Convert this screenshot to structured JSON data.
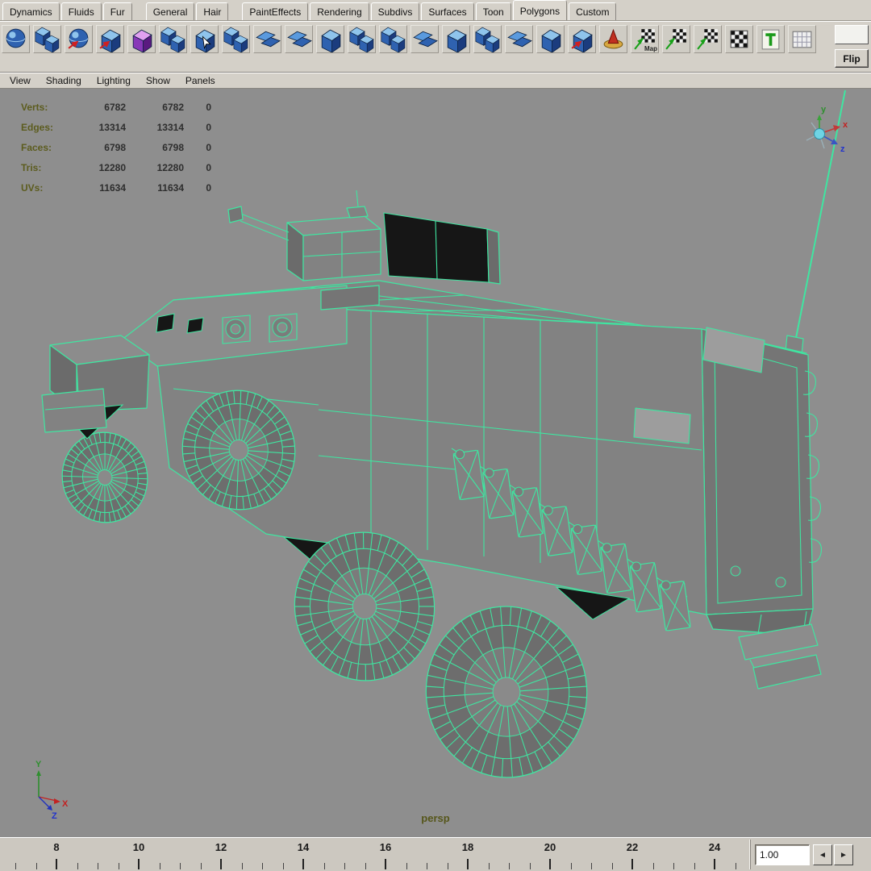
{
  "tabs": {
    "active_index": 10,
    "items": [
      {
        "label": "Dynamics"
      },
      {
        "label": "Fluids"
      },
      {
        "label": "Fur"
      },
      {
        "label": "General"
      },
      {
        "label": "Hair"
      },
      {
        "label": "PaintEffects"
      },
      {
        "label": "Rendering"
      },
      {
        "label": "Subdivs"
      },
      {
        "label": "Surfaces"
      },
      {
        "label": "Toon"
      },
      {
        "label": "Polygons"
      },
      {
        "label": "Custom"
      }
    ]
  },
  "shelf": {
    "flip_label": "Flip",
    "icons": [
      {
        "name": "shelf-poly-sphere-icon",
        "type": "sphere"
      },
      {
        "name": "shelf-poly-cubes-icon",
        "type": "cubes"
      },
      {
        "name": "shelf-smooth-sphere-icon",
        "type": "sphereArrow"
      },
      {
        "name": "shelf-poly-cube-arrow-icon",
        "type": "cubeArrow"
      },
      {
        "name": "shelf-poly-texture-cube-icon",
        "type": "cubePurple"
      },
      {
        "name": "shelf-poly-mirror-icon",
        "type": "cubes"
      },
      {
        "name": "shelf-smooth-proxy-icon",
        "type": "cubeCursor"
      },
      {
        "name": "shelf-poly-combine-icon",
        "type": "cubes"
      },
      {
        "name": "shelf-poly-extrude-icon",
        "type": "planes"
      },
      {
        "name": "shelf-poly-extrude-face-icon",
        "type": "planes"
      },
      {
        "name": "shelf-poly-bevel-icon",
        "type": "cube"
      },
      {
        "name": "shelf-poly-boolean-union-icon",
        "type": "cubes"
      },
      {
        "name": "shelf-poly-boolean-difference-icon",
        "type": "cubes"
      },
      {
        "name": "shelf-poly-triangulate-icon",
        "type": "planes"
      },
      {
        "name": "shelf-poly-quadrangulate-icon",
        "type": "cube"
      },
      {
        "name": "shelf-poly-merge-icon",
        "type": "cubes"
      },
      {
        "name": "shelf-poly-split-icon",
        "type": "planes"
      },
      {
        "name": "shelf-poly-subdivide-icon",
        "type": "cube"
      },
      {
        "name": "shelf-poly-smooth-icon",
        "type": "cubeArrow"
      },
      {
        "name": "shelf-sculpt-tool-icon",
        "type": "sculpt"
      },
      {
        "name": "shelf-uv-map-icon",
        "type": "checkerArrow",
        "label": "Map"
      },
      {
        "name": "shelf-uv-checker-icon",
        "type": "checkerArrow"
      },
      {
        "name": "shelf-uv-snapshot-icon",
        "type": "checkerArrow"
      },
      {
        "name": "shelf-checker-icon",
        "type": "checker"
      },
      {
        "name": "shelf-text-tool-icon",
        "type": "tIcon"
      },
      {
        "name": "shelf-uv-grid-icon",
        "type": "grid"
      }
    ]
  },
  "panel_menu": {
    "items": [
      {
        "label": "View"
      },
      {
        "label": "Shading"
      },
      {
        "label": "Lighting"
      },
      {
        "label": "Show"
      },
      {
        "label": "Panels"
      }
    ]
  },
  "hud": {
    "rows": [
      {
        "label": "Verts:",
        "c1": "6782",
        "c2": "6782",
        "c3": "0"
      },
      {
        "label": "Edges:",
        "c1": "13314",
        "c2": "13314",
        "c3": "0"
      },
      {
        "label": "Faces:",
        "c1": "6798",
        "c2": "6798",
        "c3": "0"
      },
      {
        "label": "Tris:",
        "c1": "12280",
        "c2": "12280",
        "c3": "0"
      },
      {
        "label": "UVs:",
        "c1": "11634",
        "c2": "11634",
        "c3": "0"
      }
    ]
  },
  "viewport": {
    "camera_label": "persp",
    "wire_color": "#3fe6a1",
    "bg": "#8e8e8e"
  },
  "gizmo": {
    "x": "x",
    "y": "y",
    "z": "z"
  },
  "origin_axis": {
    "x": "X",
    "y": "Y",
    "z": "Z"
  },
  "timeline": {
    "labels": [
      "8",
      "10",
      "12",
      "14",
      "16",
      "18",
      "20",
      "22",
      "24"
    ],
    "field_value": "1.00"
  }
}
